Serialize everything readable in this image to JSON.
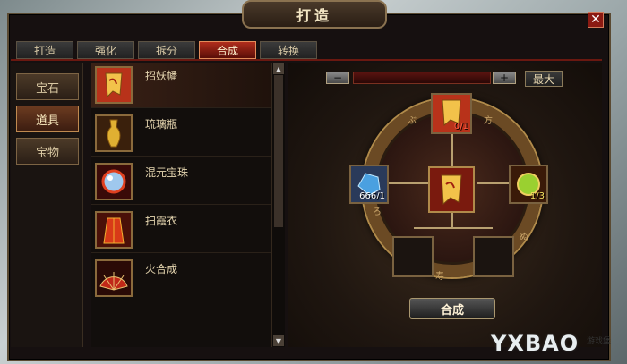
{
  "window": {
    "title": "打造",
    "close_icon": "close-icon"
  },
  "tabs": [
    {
      "label": "打造",
      "active": false
    },
    {
      "label": "强化",
      "active": false
    },
    {
      "label": "拆分",
      "active": false
    },
    {
      "label": "合成",
      "active": true
    },
    {
      "label": "转换",
      "active": false
    }
  ],
  "categories": [
    {
      "label": "宝石",
      "active": false
    },
    {
      "label": "道具",
      "active": true
    },
    {
      "label": "宝物",
      "active": false
    }
  ],
  "items": [
    {
      "name": "招妖幡",
      "icon": "banner-icon",
      "selected": true
    },
    {
      "name": "琉璃瓶",
      "icon": "vase-icon",
      "selected": false
    },
    {
      "name": "混元宝珠",
      "icon": "orb-icon",
      "selected": false
    },
    {
      "name": "扫霞衣",
      "icon": "robe-icon",
      "selected": false
    },
    {
      "name": "火合成",
      "icon": "fan-icon",
      "selected": false
    }
  ],
  "quantity": {
    "minus": "−",
    "plus": "+",
    "max_label": "最大"
  },
  "slots": {
    "top": {
      "icon": "banner-icon",
      "count": "0/1"
    },
    "left": {
      "icon": "crystal-icon",
      "count": "666/1"
    },
    "right": {
      "icon": "pearl-icon",
      "count": "1/3"
    },
    "center": {
      "icon": "banner-icon"
    }
  },
  "craft_button": "合成",
  "watermark": {
    "text": "YXBAO",
    "sub": "游戏堡"
  },
  "colors": {
    "accent_red": "#b02d1c",
    "gold_border": "#8a7250"
  }
}
